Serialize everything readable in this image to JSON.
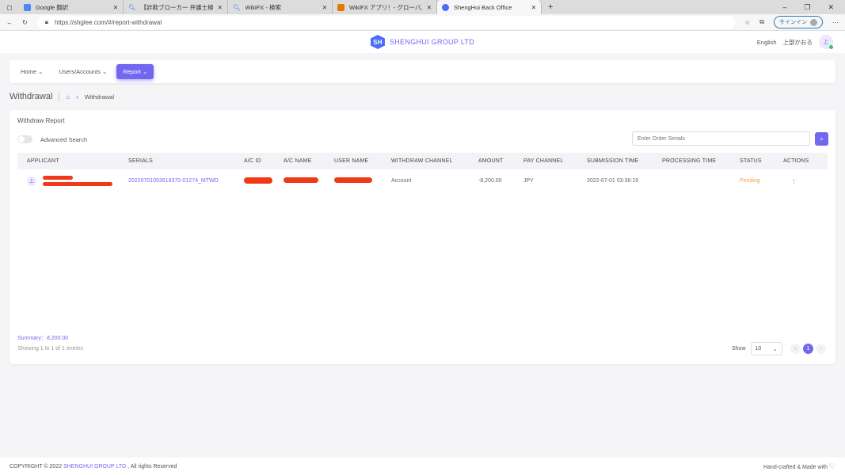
{
  "browser": {
    "tabs": [
      {
        "label": "Google 翻訳",
        "color": "#4a8af4"
      },
      {
        "label": "【詐欺ブローカー 弁護士検索 - 検索",
        "color": "#2a6fd6"
      },
      {
        "label": "WikiFX - 検索",
        "color": "#2a6fd6"
      },
      {
        "label": "WikiFX アプリ！- グローバルブローカー",
        "color": "#e07b00"
      },
      {
        "label": "ShengHui Back Office",
        "color": "#4a6cf7"
      }
    ],
    "url": "https://shglee.com/#/report-withdrawal",
    "signin": "サインイン"
  },
  "header": {
    "logo_mark": "SH",
    "brand": "SHENGHUI GROUP LTD",
    "language": "English",
    "user_name": "上部かおる",
    "avatar": "上"
  },
  "nav": {
    "items": [
      {
        "label": "Home"
      },
      {
        "label": "Users/Accounts"
      },
      {
        "label": "Report"
      }
    ]
  },
  "breadcrumb": {
    "title": "Withdrawal",
    "current": "Withdrawal"
  },
  "card": {
    "title": "Withdraw Report",
    "advanced_search": "Advanced Search",
    "search_placeholder": "Enter Order Serials"
  },
  "table": {
    "headers": [
      "APPLICANT",
      "SERIALS",
      "A/C ID",
      "A/C NAME",
      "USER NAME",
      "WITHDRAW CHANNEL",
      "AMOUNT",
      "PAY CHANNEL",
      "SUBMISSION TIME",
      "PROCESSING TIME",
      "STATUS",
      "ACTIONS"
    ],
    "rows": [
      {
        "avatar": "上",
        "serial": "20220701053619370-01274_MTWD",
        "channel": "Account",
        "amount": "-8,200.00",
        "pay_channel": "JPY",
        "submission_time": "2022-07-01 03:36:19",
        "processing_time": "",
        "status": "Pending",
        "actions": "⋮"
      }
    ]
  },
  "summary": "Summary：8,200.00",
  "showing": "Showing 1 to 1 of 1 entries",
  "show_label": "Show",
  "page_size": "10",
  "current_page": "1",
  "footer": {
    "copyright": "COPYRIGHT © 2022",
    "brand": "SHENGHUI GROUP LTD",
    "rights": ", All rights Reserved",
    "right": "Hand-crafted & Made with"
  },
  "colors": {
    "accent": "#7367f0",
    "pending": "#ff9f43"
  }
}
